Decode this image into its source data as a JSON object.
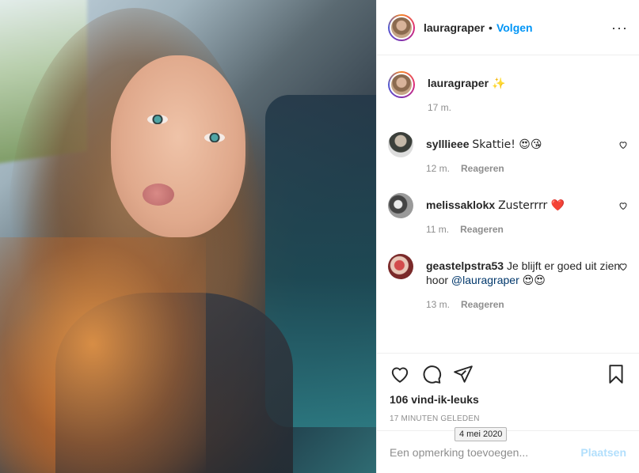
{
  "header": {
    "username": "lauragraper",
    "separator": "•",
    "follow_label": "Volgen",
    "more_label": "···"
  },
  "caption": {
    "username": "lauragraper",
    "text": "✨",
    "age": "17 m."
  },
  "comments": [
    {
      "username": "sylllieee",
      "text": "Skattie! 😍😘",
      "age": "12 m.",
      "reply_label": "Reageren"
    },
    {
      "username": "melissaklokx",
      "text": "Zusterrrr ❤️",
      "age": "11 m.",
      "reply_label": "Reageren"
    },
    {
      "username": "geastelpstra53",
      "text": "Je blijft er goed uit zien hoor",
      "mention": "@lauragraper",
      "emoji": "😍😍",
      "age": "13 m.",
      "reply_label": "Reageren"
    }
  ],
  "actions": {
    "likes": "106 vind-ik-leuks",
    "posted_ago": "17 minuten geleden",
    "tooltip_date": "4 mei 2020"
  },
  "add_comment": {
    "placeholder": "Een opmerking toevoegen...",
    "post_label": "Plaatsen"
  },
  "icons": {
    "like": "heart-icon",
    "comment": "comment-icon",
    "share": "share-icon",
    "save": "bookmark-icon",
    "comment_like": "heart-icon"
  },
  "colors": {
    "follow": "#0095f6",
    "post_disabled": "#b2dffc",
    "muted": "#8e8e8e",
    "mention": "#00376b"
  }
}
